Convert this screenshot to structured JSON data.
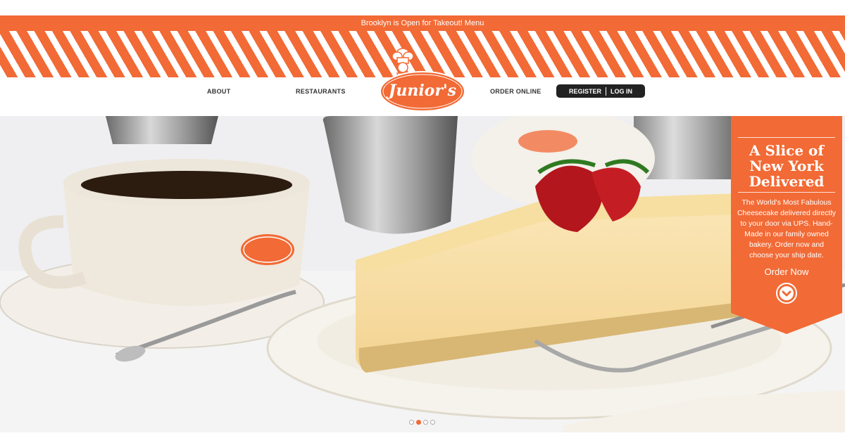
{
  "announcement": {
    "text": "Brooklyn is Open for Takeout! Menu"
  },
  "nav": {
    "about": "ABOUT",
    "restaurants": "RESTAURANTS",
    "order_online": "ORDER ONLINE",
    "register": "REGISTER",
    "login": "LOG IN"
  },
  "logo": {
    "text": "Junior's"
  },
  "promo": {
    "title": "A Slice of New York Delivered",
    "body": "The World's Most Fabulous Cheesecake delivered directly to your door via UPS. Hand-Made in our family owned bakery. Order now and choose your ship date.",
    "cta": "Order Now"
  },
  "carousel": {
    "slides": 4,
    "active_index": 1
  },
  "colors": {
    "brand_orange": "#f26a35",
    "dark": "#222222"
  },
  "icons": [
    "chef-icon",
    "chevron-down-icon"
  ]
}
